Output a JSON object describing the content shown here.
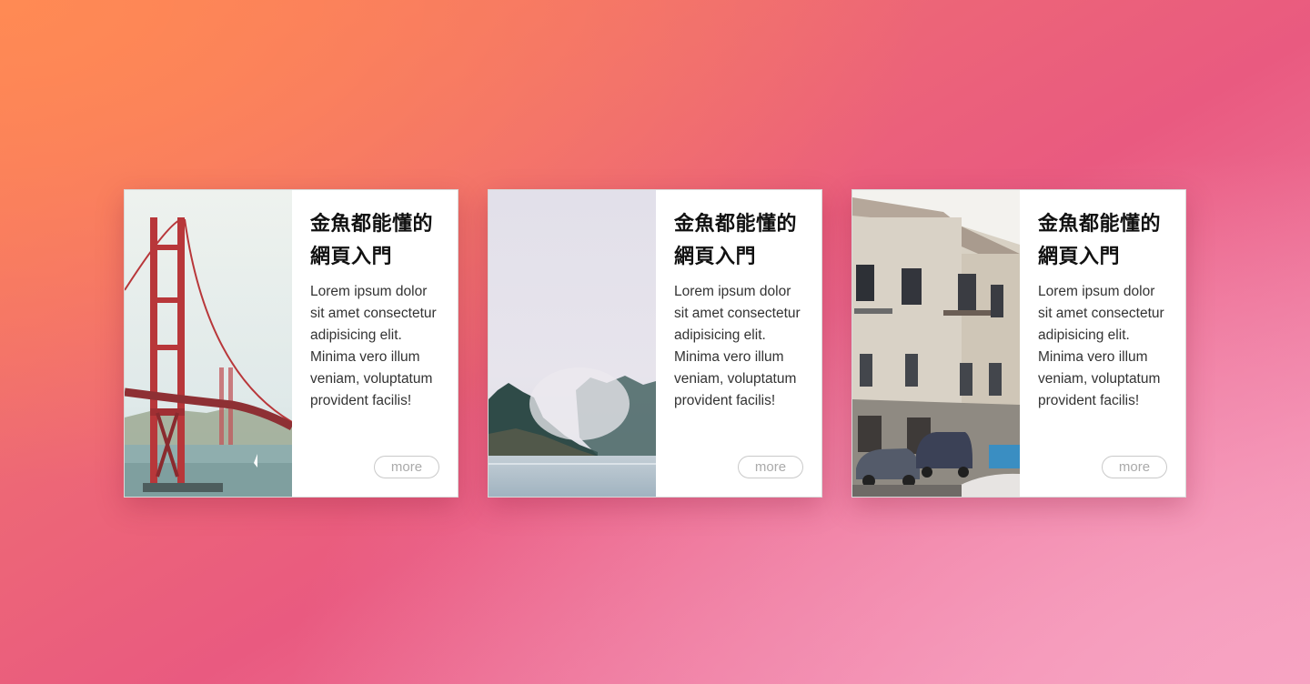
{
  "cards": [
    {
      "image": "golden-gate-bridge-photo",
      "title": "金魚都能懂的網頁入門",
      "description": "Lorem ipsum dolor sit amet consectetur adipisicing elit. Minima vero illum veniam, voluptatum provident facilis!",
      "button": "more"
    },
    {
      "image": "foggy-forest-lake-photo",
      "title": "金魚都能懂的網頁入門",
      "description": "Lorem ipsum dolor sit amet consectetur adipisicing elit. Minima vero illum veniam, voluptatum provident facilis!",
      "button": "more"
    },
    {
      "image": "old-town-street-photo",
      "title": "金魚都能懂的網頁入門",
      "description": "Lorem ipsum dolor sit amet consectetur adipisicing elit. Minima vero illum veniam, voluptatum provident facilis!",
      "button": "more"
    }
  ],
  "colors": {
    "background_start": "#ff8a54",
    "background_mid": "#e95a80",
    "background_end": "#f7a0bf",
    "card": "#ffffff",
    "button_border": "#c9c9c9",
    "button_text": "#aaaaaa"
  }
}
